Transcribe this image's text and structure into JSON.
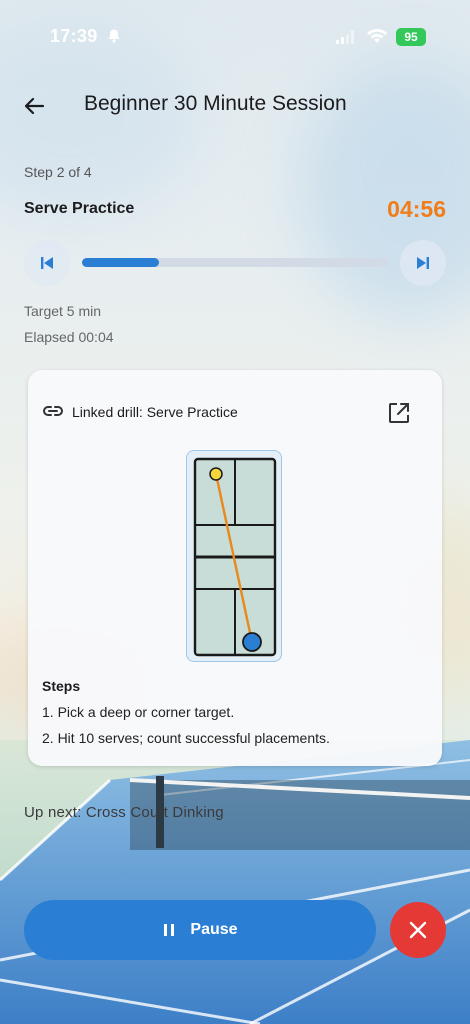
{
  "status_bar": {
    "time": "17:39",
    "battery": "95",
    "icons": [
      "bell-off-icon",
      "signal-icon",
      "wifi-icon",
      "battery-icon"
    ]
  },
  "header": {
    "title": "Beginner 30 Minute Session",
    "back_icon": "arrow-left-icon"
  },
  "session": {
    "step_count": "Step 2 of 4",
    "step_name": "Serve Practice",
    "timer": "04:56",
    "progress": 0.25,
    "target": "Target 5 min",
    "elapsed": "Elapsed 00:04"
  },
  "card": {
    "linked_label": "Linked drill: Serve Practice",
    "link_icon": "link-icon",
    "open_icon": "open-external-icon",
    "steps_heading": "Steps",
    "steps": [
      "1. Pick a deep or corner target.",
      "2. Hit 10 serves; count successful placements."
    ]
  },
  "up_next": "Up next: Cross Court Dinking",
  "controls": {
    "pause_label": "Pause",
    "stop_icon": "close-icon"
  },
  "colors": {
    "accent": "#2a7fd4",
    "timer": "#f07d1a",
    "stop": "#e53935",
    "court": "#c8ddd7"
  }
}
